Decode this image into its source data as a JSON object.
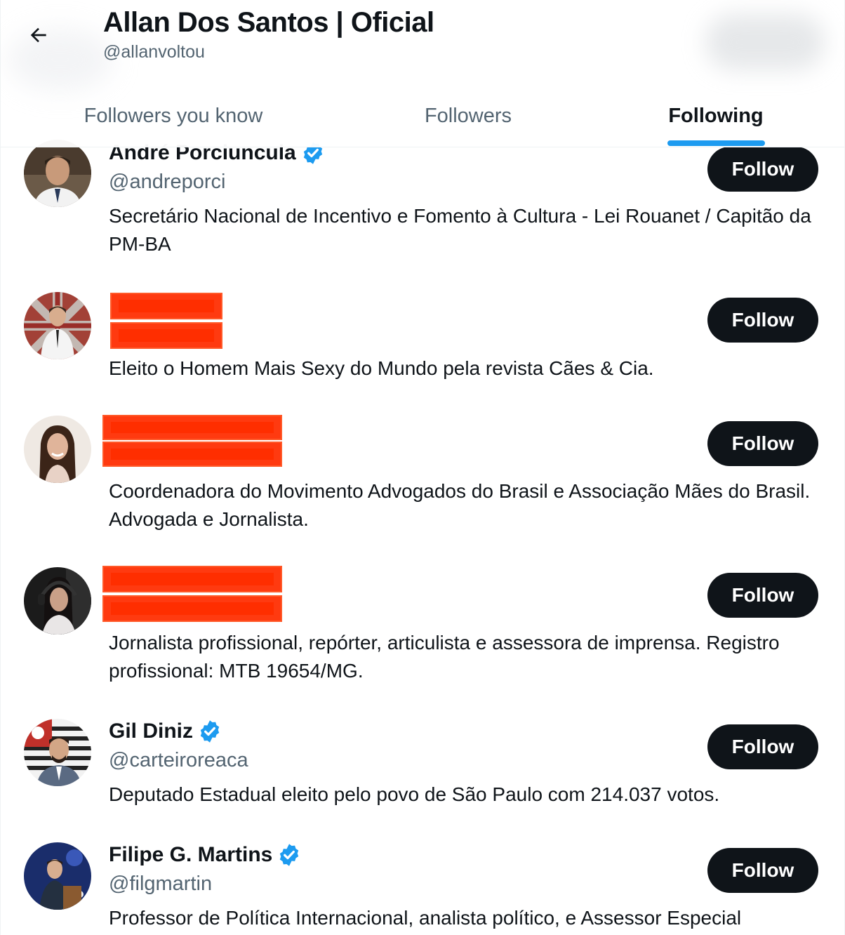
{
  "header": {
    "profile_name": "Allan Dos Santos | Oficial",
    "profile_handle": "@allanvoltou",
    "back_icon": "arrow-left-icon"
  },
  "tabs": [
    {
      "label": "Followers you know",
      "active": false
    },
    {
      "label": "Followers",
      "active": false
    },
    {
      "label": "Following",
      "active": true
    }
  ],
  "colors": {
    "accent": "#1d9bf0",
    "button_bg": "#0f1419",
    "button_text": "#ffffff",
    "secondary_text": "#536471",
    "redaction": "#ff2e00"
  },
  "users": [
    {
      "name": "André Porciuncula",
      "verified": true,
      "handle": "@andreporci",
      "bio": "Secretário Nacional de Incentivo e Fomento à Cultura - Lei Rouanet / Capitão da PM-BA",
      "follow_label": "Follow"
    },
    {
      "name": "",
      "verified": false,
      "handle": "",
      "redacted": true,
      "bio": "Eleito o Homem Mais Sexy do Mundo pela revista Cães & Cia.",
      "follow_label": "Follow"
    },
    {
      "name": "",
      "verified": false,
      "handle": "",
      "redacted": true,
      "bio": "Coordenadora do Movimento Advogados do Brasil e Associação Mães do Brasil. Advogada e Jornalista.",
      "follow_label": "Follow"
    },
    {
      "name": "",
      "verified": false,
      "handle": "",
      "redacted": true,
      "bio": "Jornalista profissional, repórter, articulista e assessora de imprensa. Registro profissional: MTB 19654/MG.",
      "follow_label": "Follow"
    },
    {
      "name": "Gil Diniz",
      "verified": true,
      "handle": "@carteiroreaca",
      "bio": "Deputado Estadual eleito pelo povo de São Paulo com 214.037 votos.",
      "follow_label": "Follow"
    },
    {
      "name": "Filipe G. Martins",
      "verified": true,
      "handle": "@filgmartin",
      "bio": "Professor de Política Internacional, analista político, e Assessor Especial",
      "follow_label": "Follow"
    }
  ]
}
